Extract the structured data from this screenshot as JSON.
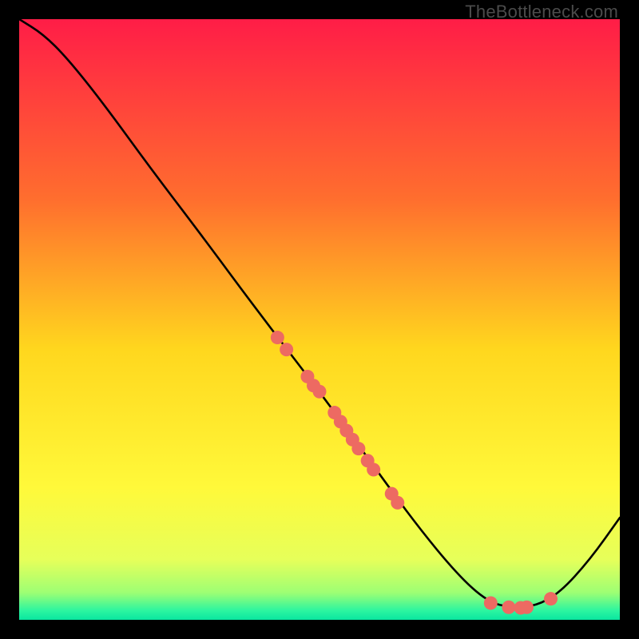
{
  "watermark": "TheBottleneck.com",
  "chart_data": {
    "type": "line",
    "title": "",
    "xlabel": "",
    "ylabel": "",
    "xlim": [
      0,
      100
    ],
    "ylim": [
      0,
      100
    ],
    "grid": false,
    "legend": false,
    "background_gradient": {
      "stops": [
        {
          "pos": 0.0,
          "color": "#ff1d47"
        },
        {
          "pos": 0.3,
          "color": "#ff6e2e"
        },
        {
          "pos": 0.55,
          "color": "#ffd71e"
        },
        {
          "pos": 0.78,
          "color": "#fff93a"
        },
        {
          "pos": 0.9,
          "color": "#e6ff5a"
        },
        {
          "pos": 0.955,
          "color": "#9dff74"
        },
        {
          "pos": 0.985,
          "color": "#2bf5a0"
        },
        {
          "pos": 1.0,
          "color": "#0ae6a0"
        }
      ]
    },
    "series": [
      {
        "name": "curve",
        "stroke": "#000000",
        "points": [
          {
            "x": 0.0,
            "y": 100.0
          },
          {
            "x": 4.0,
            "y": 97.5
          },
          {
            "x": 8.0,
            "y": 93.5
          },
          {
            "x": 14.0,
            "y": 86.0
          },
          {
            "x": 22.0,
            "y": 75.0
          },
          {
            "x": 30.0,
            "y": 64.5
          },
          {
            "x": 40.0,
            "y": 51.0
          },
          {
            "x": 50.0,
            "y": 38.0
          },
          {
            "x": 58.0,
            "y": 27.0
          },
          {
            "x": 66.0,
            "y": 16.0
          },
          {
            "x": 73.0,
            "y": 7.5
          },
          {
            "x": 78.0,
            "y": 3.0
          },
          {
            "x": 82.0,
            "y": 2.0
          },
          {
            "x": 86.0,
            "y": 2.3
          },
          {
            "x": 90.0,
            "y": 4.5
          },
          {
            "x": 95.0,
            "y": 10.0
          },
          {
            "x": 100.0,
            "y": 17.0
          }
        ]
      }
    ],
    "marker_clusters": [
      {
        "name": "cluster-upper",
        "color": "#ed6a62",
        "points": [
          {
            "x": 43.0,
            "y": 47.0
          },
          {
            "x": 44.5,
            "y": 45.0
          },
          {
            "x": 48.0,
            "y": 40.5
          },
          {
            "x": 49.0,
            "y": 39.0
          },
          {
            "x": 50.0,
            "y": 38.0
          },
          {
            "x": 52.5,
            "y": 34.5
          },
          {
            "x": 53.5,
            "y": 33.0
          },
          {
            "x": 54.5,
            "y": 31.5
          },
          {
            "x": 55.5,
            "y": 30.0
          },
          {
            "x": 56.5,
            "y": 28.5
          },
          {
            "x": 58.0,
            "y": 26.5
          },
          {
            "x": 59.0,
            "y": 25.0
          },
          {
            "x": 62.0,
            "y": 21.0
          },
          {
            "x": 63.0,
            "y": 19.5
          }
        ]
      },
      {
        "name": "cluster-valley",
        "color": "#ed6a62",
        "points": [
          {
            "x": 78.5,
            "y": 2.8
          },
          {
            "x": 81.5,
            "y": 2.1
          },
          {
            "x": 83.5,
            "y": 2.0
          },
          {
            "x": 84.5,
            "y": 2.1
          },
          {
            "x": 88.5,
            "y": 3.5
          }
        ]
      }
    ]
  }
}
